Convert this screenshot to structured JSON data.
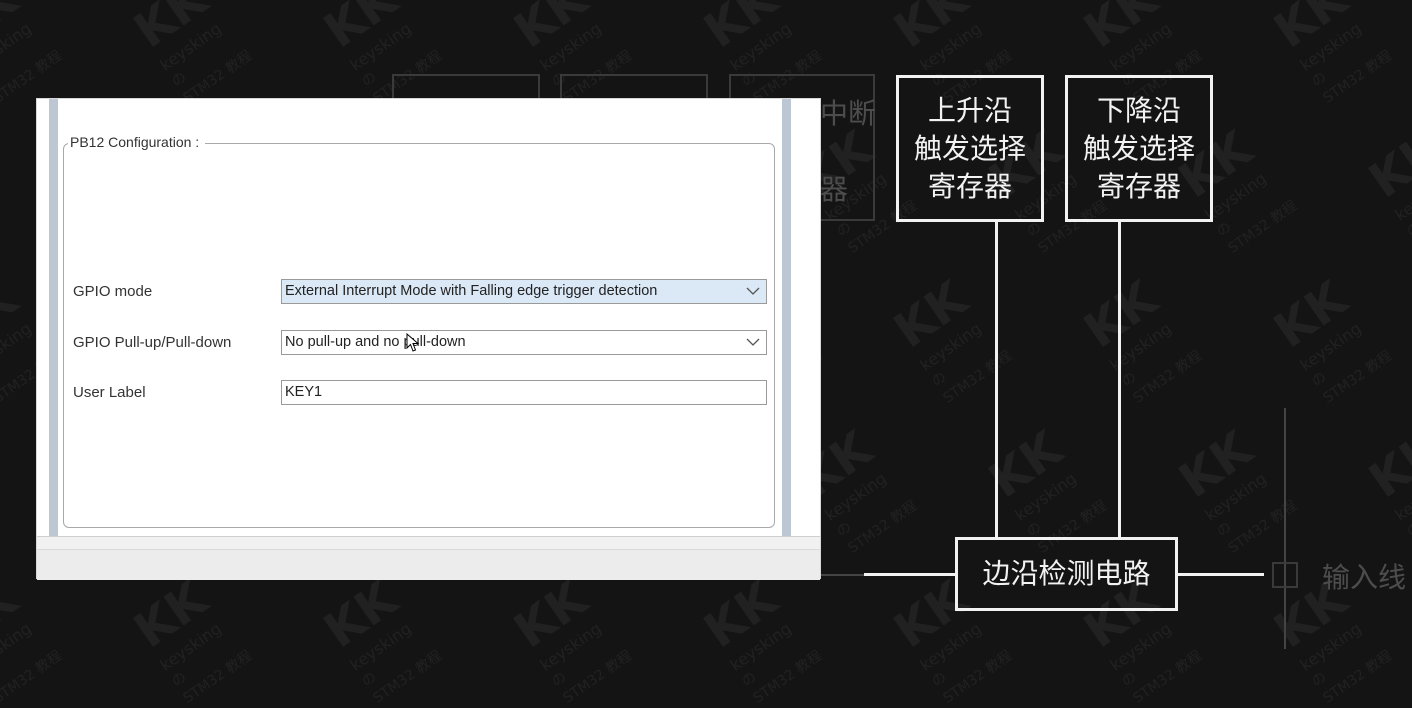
{
  "diagram": {
    "rising_register": [
      "上升沿",
      "触发选择",
      "寄存器"
    ],
    "falling_register": [
      "下降沿",
      "触发选择",
      "寄存器"
    ],
    "edge_detect": "边沿检测电路",
    "input_line": "输入线",
    "faded_top_text": "中断",
    "faded_mid_text": "器"
  },
  "watermark": {
    "logo": "KK",
    "name": "keysking",
    "of": "の",
    "course": "STM32 教程"
  },
  "dialog": {
    "legend": "PB12 Configuration :",
    "rows": [
      {
        "label": "GPIO mode",
        "value": "External Interrupt Mode with Falling edge trigger detection"
      },
      {
        "label": "GPIO Pull-up/Pull-down",
        "value": "No pull-up and no pull-down"
      },
      {
        "label": "User Label",
        "value": "KEY1"
      }
    ]
  },
  "colors": {
    "background": "#141414",
    "diagram_line": "#f2f2f2",
    "select_highlight": "#dbe8f6",
    "panel_bar": "#bcc7d3"
  }
}
